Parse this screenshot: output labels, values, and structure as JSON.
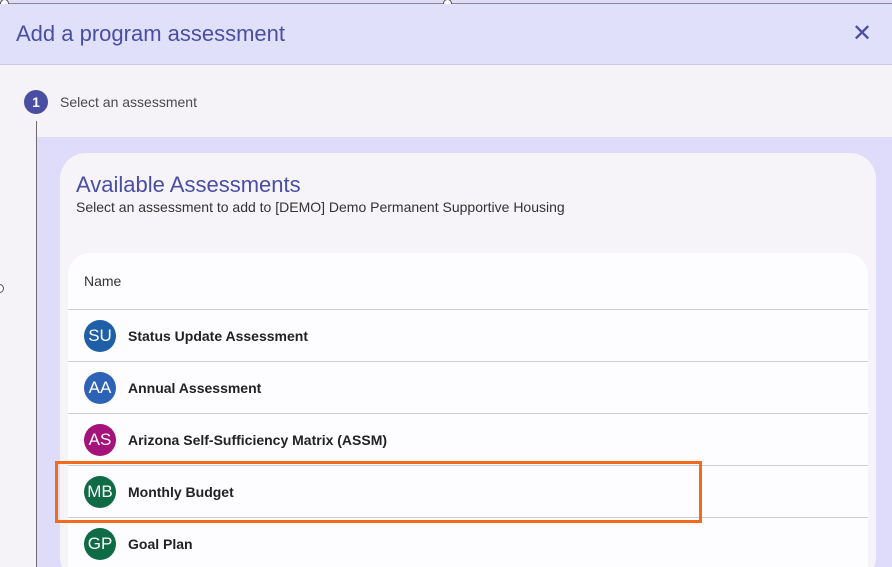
{
  "dialog": {
    "title": "Add a program assessment",
    "close_icon": "close-icon",
    "close_glyph": "✕"
  },
  "step": {
    "number": "1",
    "label": "Select an assessment"
  },
  "card": {
    "title": "Available Assessments",
    "subtitle": "Select an assessment to add to [DEMO] Demo Permanent Supportive Housing",
    "column_header": "Name"
  },
  "rows": [
    {
      "initials": "SU",
      "label": "Status Update Assessment",
      "color": "#1e5fa8"
    },
    {
      "initials": "AA",
      "label": "Annual Assessment",
      "color": "#2c63b6"
    },
    {
      "initials": "AS",
      "label": "Arizona Self-Sufficiency Matrix (ASSM)",
      "color": "#a4127a"
    },
    {
      "initials": "MB",
      "label": "Monthly Budget",
      "color": "#0e6b45"
    },
    {
      "initials": "GP",
      "label": "Goal Plan",
      "color": "#0e6b45"
    }
  ],
  "colors": {
    "accent": "#4a4ea3",
    "highlight": "#f26a1b"
  }
}
